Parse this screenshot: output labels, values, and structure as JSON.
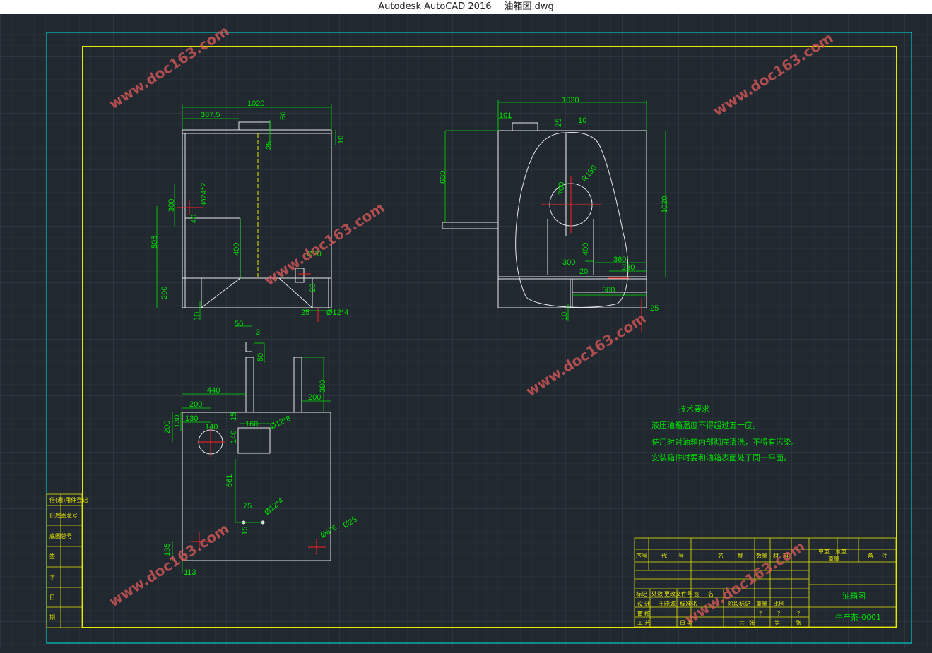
{
  "window": {
    "app_title": "Autodesk AutoCAD 2016",
    "file_name": "油箱图.dwg"
  },
  "colors": {
    "background": "#212830",
    "grid": "#2c3440",
    "border_outer": "#00c8c8",
    "border_inner": "#e8e800",
    "drawing": "#e8e8e8",
    "dimension": "#00e000",
    "center": "#ff2020",
    "dashed": "#e8e800",
    "watermark": "#e05a5a"
  },
  "watermark": "www.doc163.com",
  "front_view": {
    "dims": {
      "d1020": "1020",
      "d387": "387.5",
      "d50": "50",
      "d25": "25",
      "d10a": "10",
      "d300": "300",
      "d505": "505",
      "d40": "40",
      "d24": "Ø24*2",
      "d400": "400",
      "d200": "200",
      "d10b": "10",
      "d20": "Ø20",
      "d20b": "20",
      "d25b": "25",
      "d12": "Ø12*4"
    }
  },
  "side_view": {
    "dims": {
      "d1020": "1020",
      "d101": "101",
      "d25": "25",
      "d10": "10",
      "d630": "630",
      "d700": "700",
      "r150": "R150",
      "d1020v": "1020",
      "d400": "400",
      "d300": "300",
      "d20": "20",
      "d360": "360",
      "d230": "230",
      "d500": "500",
      "d10b": "10",
      "d25b": "25"
    }
  },
  "top_view": {
    "dims": {
      "d50": "50",
      "d3": "3",
      "d50v": "50",
      "d380": "380",
      "d440": "440",
      "d200": "200",
      "d200b": "200",
      "d130": "130",
      "d200v": "200",
      "d130v": "130",
      "d140": "140",
      "d160": "160",
      "d12x8": "Ø12*8",
      "d140v": "140",
      "d15": "15",
      "d561": "561",
      "d75": "75",
      "d15b": "15",
      "d12x4": "Ø12*4",
      "d6x6": "Ø6*6",
      "d25": "Ø25",
      "d135": "135",
      "d113": "113"
    }
  },
  "tech_notes": {
    "title": "技术要求",
    "lines": [
      "液压油箱温度不得超过五十度。",
      "使用时对油箱内部彻底清洗，不得有污染。",
      "安装箱件时要和油箱表面处于同一平面。"
    ]
  },
  "title_block": {
    "headers": [
      "序号",
      "代",
      "号",
      "名",
      "称",
      "数量",
      "材",
      "料",
      "单重",
      "总重",
      "备",
      "注"
    ],
    "weight_sub": "重量",
    "drawing_name": "油箱图",
    "drawing_no": "牛产茶-0001",
    "cells": [
      "标记",
      "处数",
      "更改文件号",
      "签",
      "名",
      "设",
      "计",
      "王晓城",
      "标准化",
      "审",
      "核",
      "工",
      "艺",
      "日",
      "期",
      "阶段标记",
      "重量",
      "比例",
      "共",
      "张",
      "第",
      "张"
    ],
    "marks": [
      "?",
      "?",
      "?"
    ]
  },
  "left_strip": [
    "借(通)用件登记",
    "旧底图总号",
    "底图总号",
    "签",
    "字",
    "日",
    "期"
  ]
}
